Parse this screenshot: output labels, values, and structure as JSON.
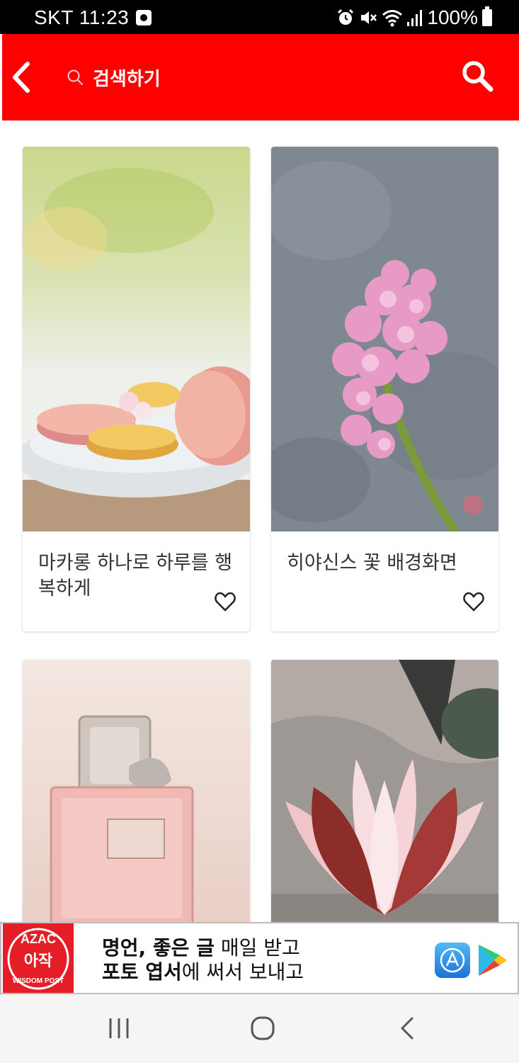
{
  "status_bar": {
    "carrier_time": "SKT 11:23",
    "battery": "100%"
  },
  "header": {
    "search_hint": "검색하기",
    "accent_color": "#fe0000"
  },
  "cards": [
    {
      "title": "마카롱 하나로 하루를 행복하게",
      "image": "macarons-photo"
    },
    {
      "title": "히야신스 꽃 배경화면",
      "image": "hyacinth-photo"
    },
    {
      "title": "",
      "image": "perfume-photo"
    },
    {
      "title": "",
      "image": "water-lily-photo"
    }
  ],
  "ad": {
    "logo_text_top": "AZAC",
    "logo_text_mid": "아작",
    "logo_text_bottom": "WISDOM POST",
    "line1_bold": "명언, 좋은 글",
    "line1_rest": " 매일 받고",
    "line2_bold": "포토 엽서",
    "line2_rest": "에 써서 보내고"
  }
}
